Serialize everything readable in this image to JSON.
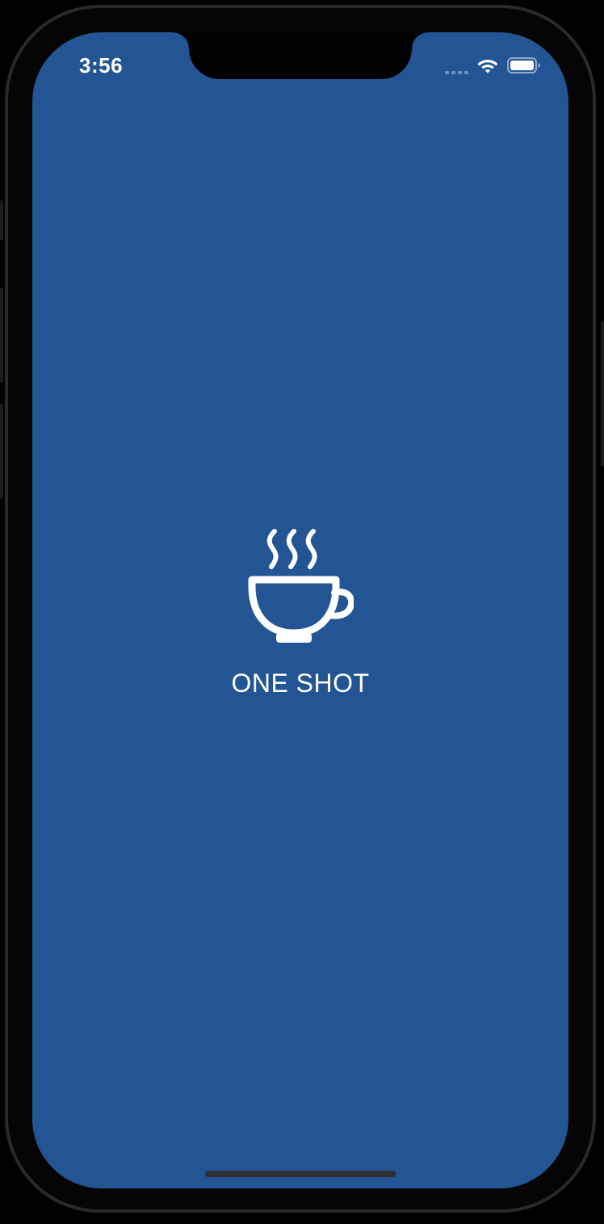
{
  "status_bar": {
    "time": "3:56",
    "wifi_icon": "wifi-icon",
    "battery_icon": "battery-icon",
    "signal_icon": "cellular-signal-icon"
  },
  "splash": {
    "icon": "coffee-cup-icon",
    "app_name": "ONE SHOT"
  },
  "colors": {
    "background": "#235594",
    "foreground": "#ffffff",
    "device_frame": "#000000"
  }
}
